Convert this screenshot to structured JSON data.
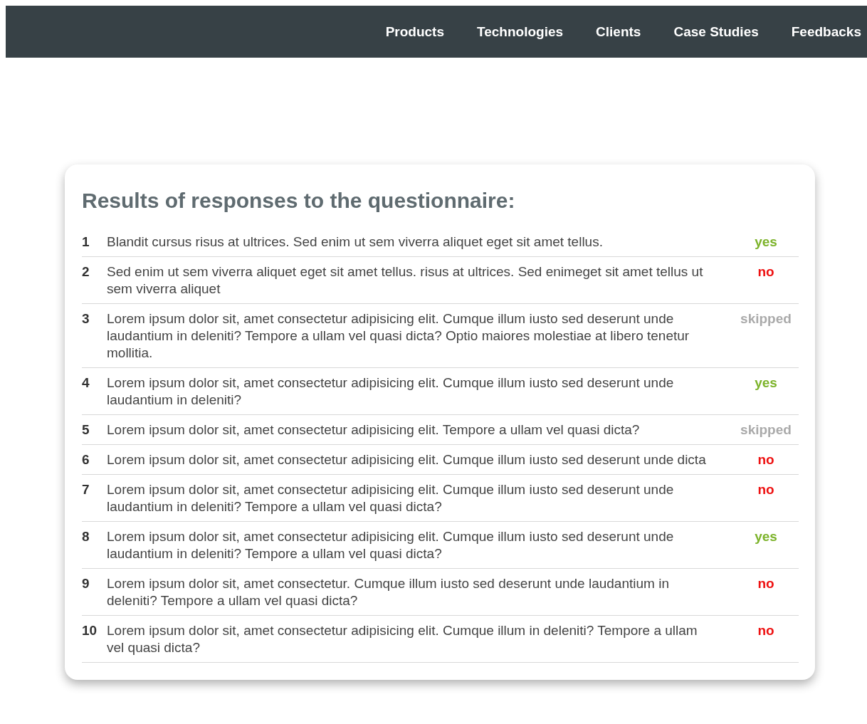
{
  "nav": {
    "items": [
      {
        "label": "Products"
      },
      {
        "label": "Technologies"
      },
      {
        "label": "Clients"
      },
      {
        "label": "Case Studies"
      },
      {
        "label": "Feedbacks"
      }
    ]
  },
  "results": {
    "title": "Results of responses to the questionnaire:",
    "rows": [
      {
        "number": "1",
        "question": "Blandit cursus risus at ultrices. Sed enim ut sem viverra aliquet eget sit amet tellus.",
        "answer": "yes",
        "kind": "yes"
      },
      {
        "number": "2",
        "question": "Sed enim ut sem viverra aliquet eget sit amet tellus. risus at ultrices. Sed enimeget sit amet tellus ut sem viverra aliquet",
        "answer": "no",
        "kind": "no"
      },
      {
        "number": "3",
        "question": "Lorem ipsum dolor sit, amet consectetur adipisicing elit. Cumque illum iusto sed deserunt unde laudantium in deleniti? Tempore a ullam vel quasi dicta? Optio maiores molestiae at libero tenetur mollitia.",
        "answer": "skipped",
        "kind": "skipped"
      },
      {
        "number": "4",
        "question": "Lorem ipsum dolor sit, amet consectetur adipisicing elit. Cumque illum iusto sed deserunt unde laudantium in deleniti?",
        "answer": "yes",
        "kind": "yes"
      },
      {
        "number": "5",
        "question": "Lorem ipsum dolor sit, amet consectetur adipisicing elit. Tempore a ullam vel quasi dicta?",
        "answer": "skipped",
        "kind": "skipped"
      },
      {
        "number": "6",
        "question": "Lorem ipsum dolor sit, amet consectetur adipisicing elit. Cumque illum iusto sed deserunt unde dicta",
        "answer": "no",
        "kind": "no"
      },
      {
        "number": "7",
        "question": "Lorem ipsum dolor sit, amet consectetur adipisicing elit. Cumque illum iusto sed deserunt unde laudantium in deleniti? Tempore a ullam vel quasi dicta?",
        "answer": "no",
        "kind": "no"
      },
      {
        "number": "8",
        "question": "Lorem ipsum dolor sit, amet consectetur adipisicing elit. Cumque illum iusto sed deserunt unde laudantium in deleniti? Tempore a ullam vel quasi dicta?",
        "answer": "yes",
        "kind": "yes"
      },
      {
        "number": "9",
        "question": "Lorem ipsum dolor sit, amet consectetur. Cumque illum iusto sed deserunt unde laudantium in deleniti? Tempore a ullam vel quasi dicta?",
        "answer": "no",
        "kind": "no"
      },
      {
        "number": "10",
        "question": "Lorem ipsum dolor sit, amet consectetur adipisicing elit. Cumque illum in deleniti? Tempore a ullam vel quasi dicta?",
        "answer": "no",
        "kind": "no"
      }
    ]
  }
}
